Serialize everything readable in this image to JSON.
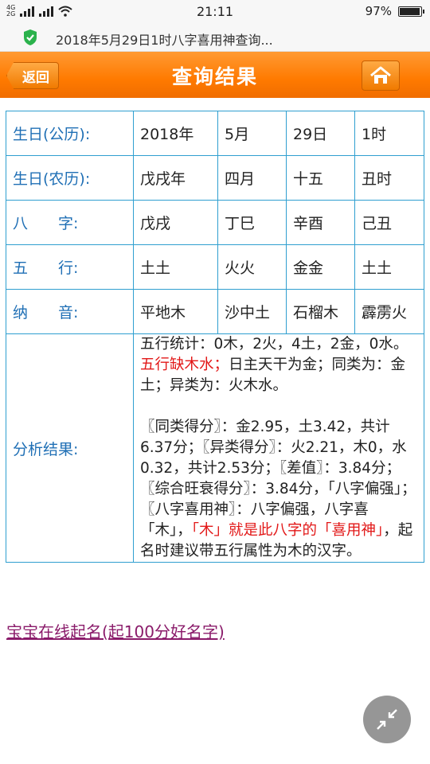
{
  "status": {
    "network_top": "4G",
    "network_bottom": "2G",
    "time": "21:11",
    "battery": "97%",
    "battery_level": 0.97
  },
  "browser": {
    "url_title": "2018年5月29日1时八字喜用神查询..."
  },
  "header": {
    "back_label": "返回",
    "title": "查询结果"
  },
  "table": {
    "rows": [
      {
        "label": "生日(公历):",
        "cells": [
          "2018年",
          "5月",
          "29日",
          "1时"
        ]
      },
      {
        "label": "生日(农历):",
        "cells": [
          "戊戌年",
          "四月",
          "十五",
          "丑时"
        ]
      },
      {
        "label": "八　　字:",
        "cells": [
          "戊戌",
          "丁巳",
          "辛酉",
          "己丑"
        ]
      },
      {
        "label": "五　　行:",
        "cells": [
          "土土",
          "火火",
          "金金",
          "土土"
        ]
      },
      {
        "label": "纳　　音:",
        "cells": [
          "平地木",
          "沙中土",
          "石榴木",
          "霹雳火"
        ]
      }
    ],
    "analysis_label": "分析结果:",
    "analysis": {
      "p1_a": "五行统计：0木，2火，4土，2金，0水。",
      "p1_red": "五行缺木水；",
      "p1_b": "日主天干为金；同类为：金土；异类为：火木水。",
      "p2_a": "〖同类得分〗：金2.95，土3.42，共计6.37分；〖异类得分〗：火2.21，木0，水0.32，共计2.53分；〖差值〗：3.84分；〖综合旺衰得分〗：3.84分，「八字偏强」；〖八字喜用神〗：八字偏强，八字喜「木」，",
      "p2_red": "「木」就是此八字的「喜用神」",
      "p2_b": "，起名时建议带五行属性为木的汉字。"
    }
  },
  "link": {
    "label": "宝宝在线起名(起100分好名字)"
  },
  "colors": {
    "header_orange": "#ff7a00",
    "table_border": "#2f9fd0",
    "label_blue": "#1f6fb5",
    "highlight_red": "#e21818",
    "link_purple": "#8a1b6a"
  }
}
